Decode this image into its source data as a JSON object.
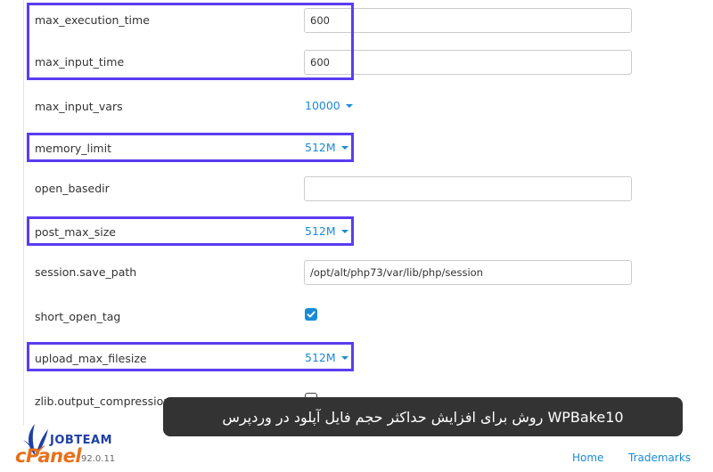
{
  "settings": [
    {
      "name": "max_execution_time",
      "type": "text",
      "value": "600"
    },
    {
      "name": "max_input_time",
      "type": "text",
      "value": "600"
    },
    {
      "name": "max_input_vars",
      "type": "select",
      "value": "10000"
    },
    {
      "name": "memory_limit",
      "type": "select",
      "value": "512M"
    },
    {
      "name": "open_basedir",
      "type": "text",
      "value": ""
    },
    {
      "name": "post_max_size",
      "type": "select",
      "value": "512M"
    },
    {
      "name": "session.save_path",
      "type": "text",
      "value": "/opt/alt/php73/var/lib/php/session"
    },
    {
      "name": "short_open_tag",
      "type": "checkbox",
      "checked": true
    },
    {
      "name": "upload_max_filesize",
      "type": "select",
      "value": "512M"
    },
    {
      "name": "zlib.output_compression",
      "type": "checkbox",
      "checked": false
    }
  ],
  "banner": {
    "text": "WPBake10 روش برای افزایش حداکثر حجم فایل آپلود در وردپرس"
  },
  "footer": {
    "version": "92.0.11",
    "home_link": "Home",
    "trademarks_link": "Trademarks"
  },
  "logo": {
    "team_text": "JOBTEAM",
    "brand_text": "cPanel"
  },
  "colors": {
    "accent": "#1a8bd6",
    "highlight": "#5b3cf0",
    "banner_bg": "#333333",
    "brand_orange": "#e8701a"
  },
  "icons": {
    "dropdown": "caret-down-icon",
    "checkbox": "check-icon"
  }
}
